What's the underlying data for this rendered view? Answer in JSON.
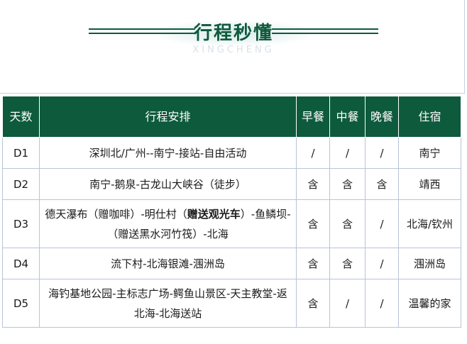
{
  "header": {
    "title": "行程秒懂",
    "subtitle": "XINGCHENG"
  },
  "table": {
    "columns": [
      "天数",
      "行程安排",
      "早餐",
      "中餐",
      "晚餐",
      "住宿"
    ],
    "rows": [
      {
        "day": "D1",
        "plan": "深圳北/广州--南宁-接站-自由活动",
        "breakfast": "/",
        "lunch": "/",
        "dinner": "/",
        "hotel": "南宁"
      },
      {
        "day": "D2",
        "plan": "南宁-鹅泉-古龙山大峡谷（徒步）",
        "breakfast": "含",
        "lunch": "含",
        "dinner": "含",
        "hotel": "靖西"
      },
      {
        "day": "D3",
        "plan_part1": "德天瀑布（赠咖啡）-明仕村（",
        "plan_bold": "赠送观光车",
        "plan_part2": "）-鱼鳞坝-（赠送黑水河竹筏）-北海",
        "breakfast": "含",
        "lunch": "含",
        "dinner": "/",
        "hotel": "北海/钦州"
      },
      {
        "day": "D4",
        "plan": "流下村-北海银滩-涠洲岛",
        "breakfast": "含",
        "lunch": "含",
        "dinner": "/",
        "hotel": "涠洲岛"
      },
      {
        "day": "D5",
        "plan": "海钓基地公园-主标志广场-鳄鱼山景区-天主教堂-返北海-北海送站",
        "breakfast": "含",
        "lunch": "/",
        "dinner": "/",
        "hotel": "温馨的家"
      }
    ]
  }
}
